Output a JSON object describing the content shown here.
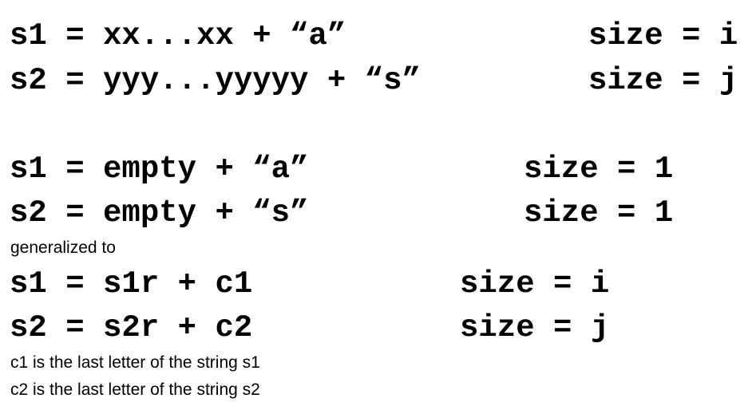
{
  "block_general": {
    "s1_expr": "s1 = xx...xx + “a”",
    "s1_size": "size = i",
    "s2_expr": "s2 = yyy...yyyyy + “s”",
    "s2_size": "size = j"
  },
  "block_base": {
    "s1_expr": "s1 = empty + “a”",
    "s1_size": "size = 1",
    "s2_expr": "s2 = empty + “s”",
    "s2_size": "size = 1"
  },
  "generalized_note": "generalized to",
  "block_generalized": {
    "s1_expr": "s1 = s1r + c1",
    "s1_size": "size = i",
    "s2_expr": "s2 = s2r + c2",
    "s2_size": "size = j"
  },
  "notes": {
    "c1": "c1 is the last letter of the string s1",
    "c2": "c2 is the last letter of the string s2"
  }
}
